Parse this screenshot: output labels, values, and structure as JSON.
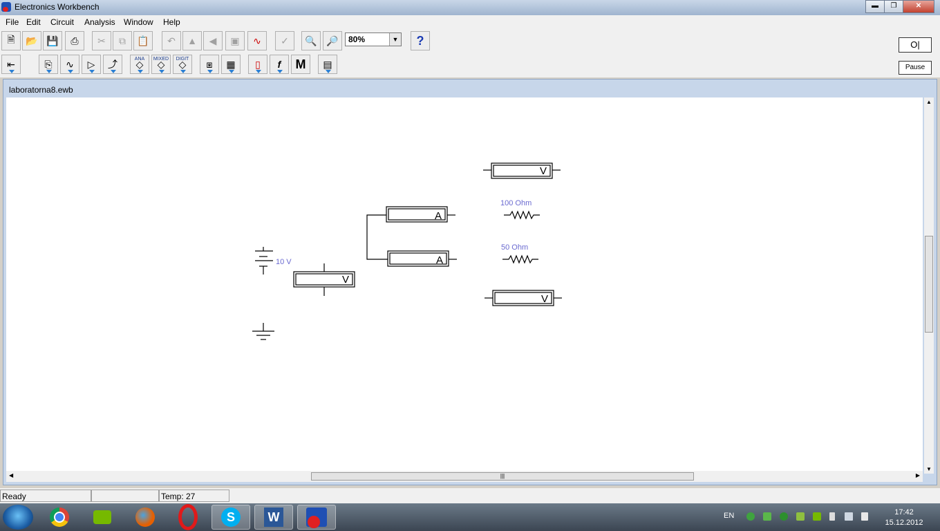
{
  "window": {
    "title": "Electronics Workbench",
    "controls": [
      "minimize",
      "maximize",
      "close"
    ]
  },
  "menu": [
    "File",
    "Edit",
    "Circuit",
    "Analysis",
    "Window",
    "Help"
  ],
  "toolbar": {
    "zoom": "80%",
    "help_label": "?",
    "pause_label": "Pause",
    "onoff_label": "O|"
  },
  "parts_bin": {
    "ana": "ANA",
    "mixed": "MIXED",
    "digit": "DIGIT",
    "misc": "M"
  },
  "document": {
    "filename": "laboratorna8.ewb"
  },
  "circuit": {
    "battery_label": "10 V",
    "r1_label": "100  Ohm",
    "r2_label": "50  Ohm",
    "voltmeter_symbol": "V",
    "ammeter_symbol": "A"
  },
  "status": {
    "text": "Ready",
    "cell2": "",
    "temp": "Temp:  27"
  },
  "taskbar": {
    "apps": [
      "chrome",
      "nvidia",
      "firefox",
      "opera",
      "skype",
      "word",
      "electronics-workbench"
    ],
    "lang": "EN",
    "time": "17:42",
    "date": "15.12.2012",
    "word_label": "W",
    "skype_label": "S"
  }
}
